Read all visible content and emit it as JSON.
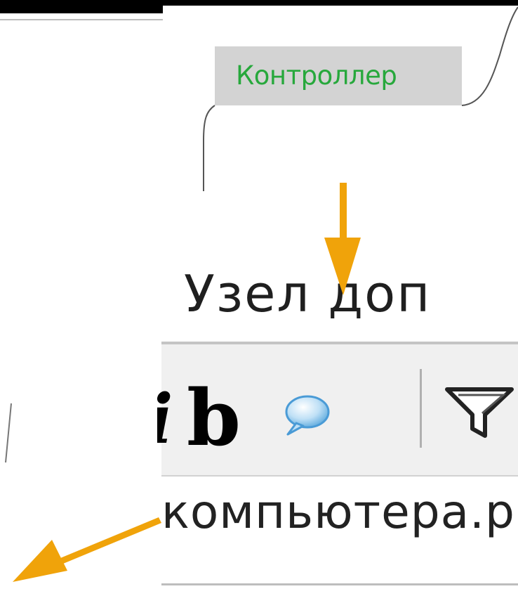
{
  "node": {
    "label": "Контроллер",
    "label_color": "#27a83c",
    "label_bg": "#d3d3d3"
  },
  "header": {
    "text": "Узел доп"
  },
  "toolbar": {
    "italic_label": "i",
    "bold_label": "b",
    "icons": [
      "comment-bubble-icon",
      "filter-icon"
    ]
  },
  "address": {
    "text": "компьютера.р"
  },
  "annotations": {
    "arrow_color": "#f0a30a",
    "arrows": [
      "down-arrow",
      "left-down-arrow"
    ]
  }
}
